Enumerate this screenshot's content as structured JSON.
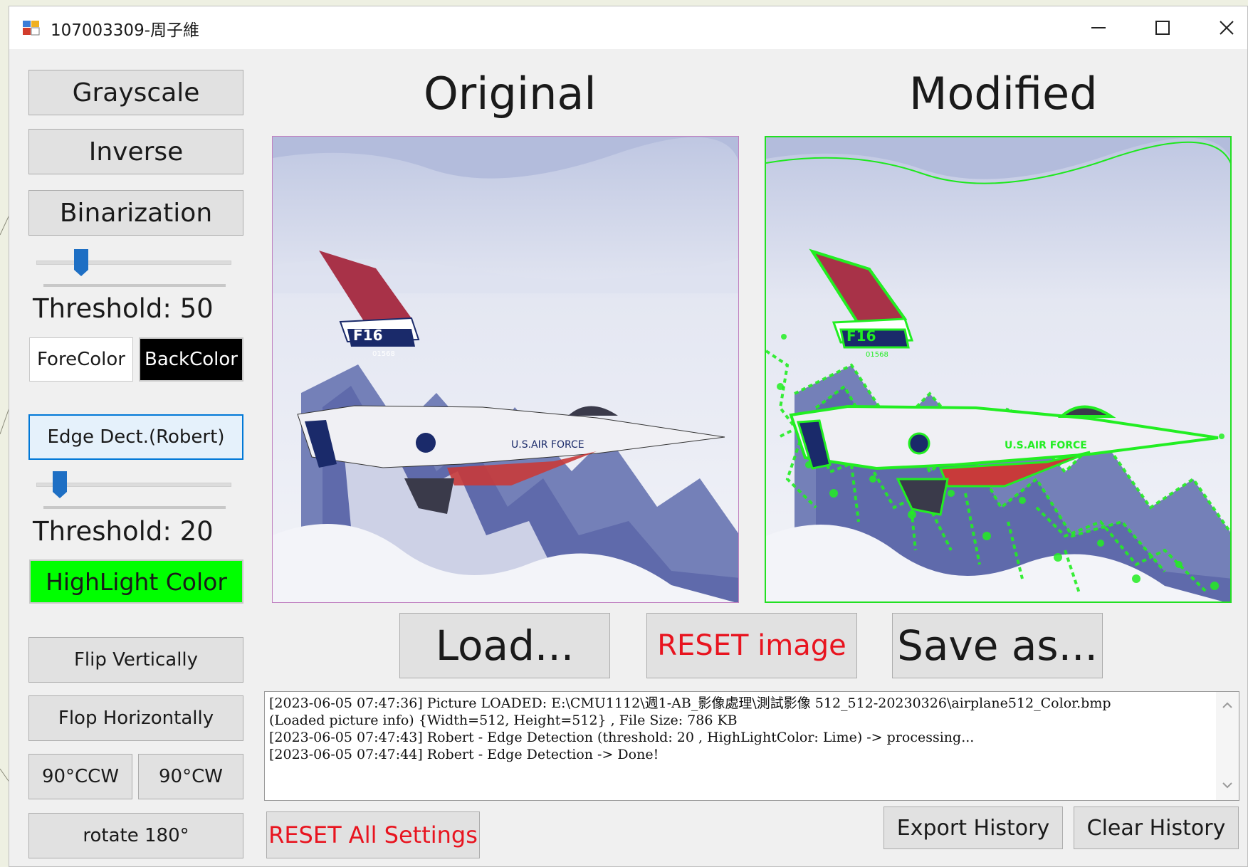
{
  "window": {
    "title": "107003309-周子維",
    "controls": {
      "minimize": "minimize-icon",
      "maximize": "maximize-icon",
      "close": "close-icon"
    }
  },
  "left_panel": {
    "grayscale": "Grayscale",
    "inverse": "Inverse",
    "binarization": "Binarization",
    "binarization_threshold_label": "Threshold: 50",
    "binarization_threshold_value": 50,
    "fore_color": "ForeColor",
    "back_color": "BackColor",
    "edge_detect": "Edge Dect.(Robert)",
    "edge_threshold_label": "Threshold: 20",
    "edge_threshold_value": 20,
    "highlight_color": "HighLight Color",
    "flip_vertically": "Flip Vertically",
    "flop_horizontally": "Flop Horizontally",
    "rotate_ccw": "90°CCW",
    "rotate_cw": "90°CW",
    "rotate_180": "rotate 180°"
  },
  "headings": {
    "original": "Original",
    "modified": "Modified"
  },
  "images": {
    "original": {
      "tail_text": "F16",
      "serial": "01568",
      "fuselage": "U.S.AIR FORCE"
    },
    "modified": {
      "tail_text": "F16",
      "serial": "01568",
      "fuselage": "U.S.AIR FORCE"
    }
  },
  "actions": {
    "load": "Load...",
    "reset_image": "RESET image",
    "save_as": "Save as..."
  },
  "log": {
    "lines": [
      "[2023-06-05 07:47:36] Picture LOADED: E:\\CMU1112\\週1-AB_影像處理\\測試影像 512_512-20230326\\airplane512_Color.bmp",
      "(Loaded picture info) {Width=512, Height=512} , File Size: 786 KB",
      "[2023-06-05 07:47:43] Robert - Edge Detection (threshold: 20 , HighLightColor: Lime) -> processing...",
      "[2023-06-05 07:47:44] Robert - Edge Detection -> Done!"
    ]
  },
  "bottom": {
    "reset_all": "RESET All Settings",
    "export_history": "Export History",
    "clear_history": "Clear History"
  },
  "colors": {
    "highlight": "#00ff00",
    "reset_red": "#e8141f",
    "focus_blue": "#0078d7",
    "slider_thumb": "#1e6fc4"
  }
}
